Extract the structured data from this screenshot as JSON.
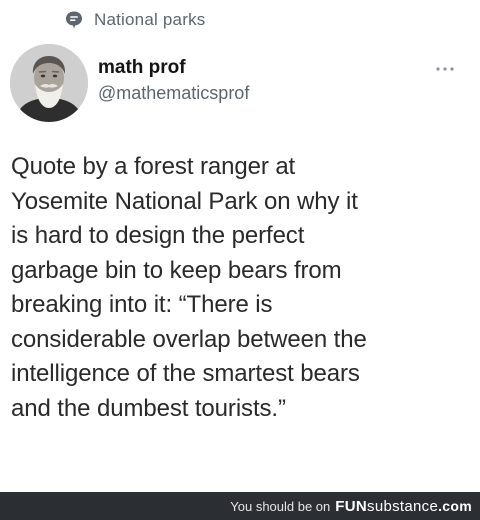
{
  "topic": {
    "label": "National parks",
    "icon": "topic-speech-bubble-icon"
  },
  "author": {
    "name": "math prof",
    "handle": "@mathematicsprof"
  },
  "tweet": {
    "text": "Quote by a forest ranger at\nYosemite National Park on why it\nis hard to design the perfect\ngarbage bin to keep bears from\nbreaking into it:  “There is\nconsiderable overlap between the\nintelligence of the smartest bears\nand the dumbest tourists.”"
  },
  "watermark": {
    "prefix": "You should be on",
    "brand_fun": "FUN",
    "brand_substance": "substance",
    "domain": ".com"
  },
  "colors": {
    "secondary_text": "#5b6670",
    "watermark_bg": "#2b2e33"
  }
}
